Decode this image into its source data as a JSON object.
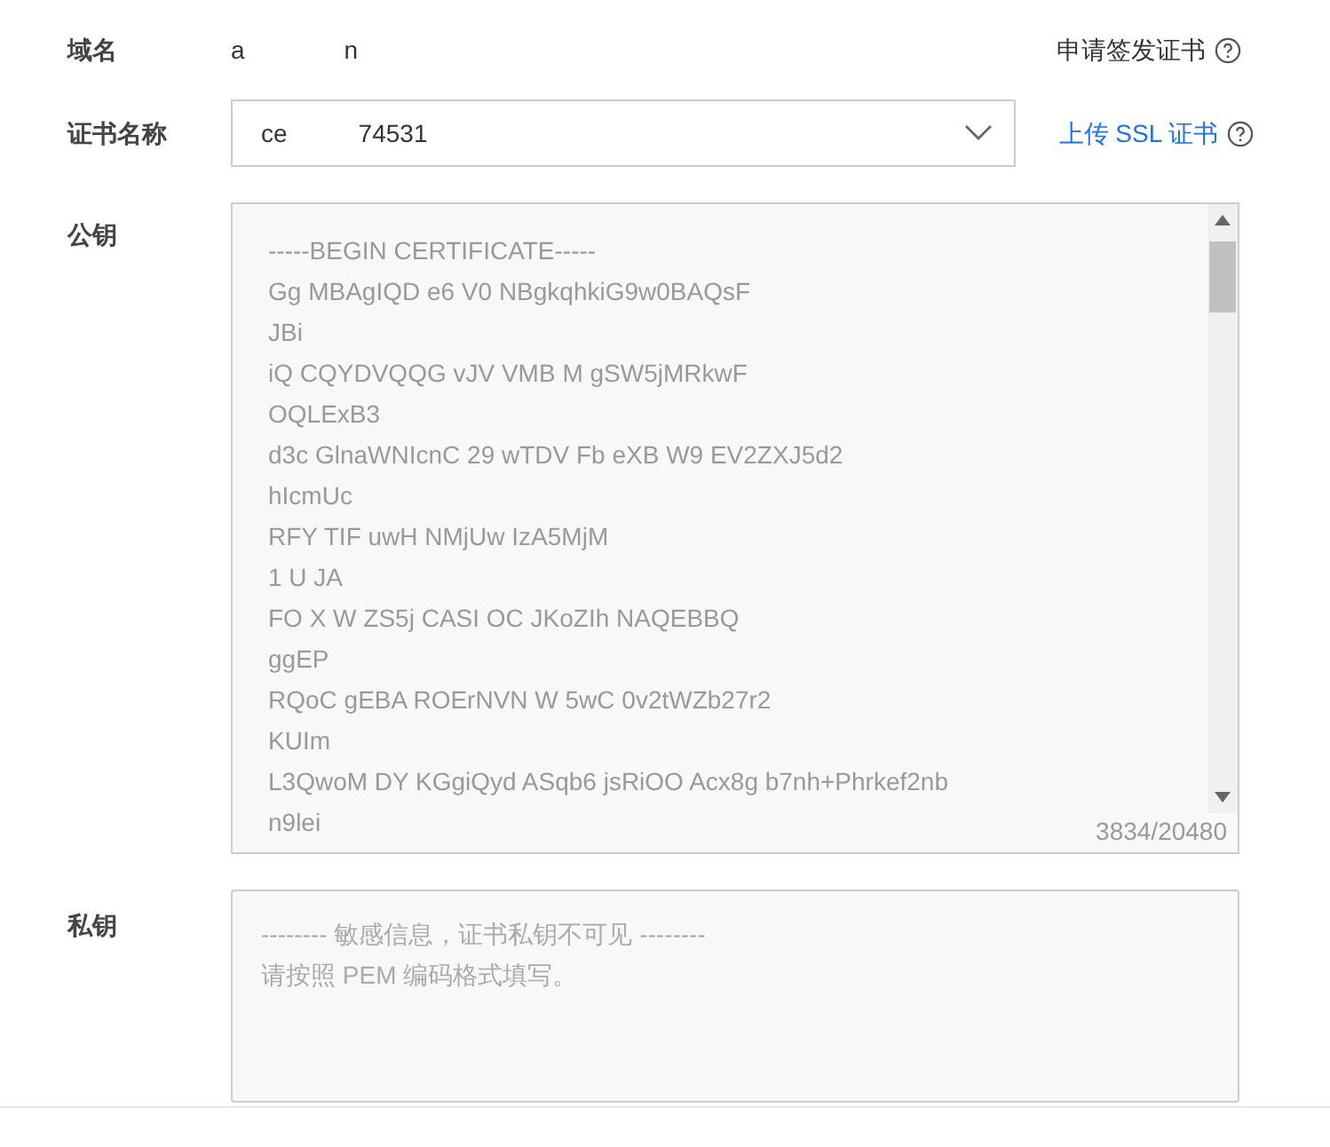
{
  "domain": {
    "label": "域名",
    "value_parts": [
      "a",
      "n"
    ],
    "action": "申请签发证书"
  },
  "cert_name": {
    "label": "证书名称",
    "value_parts": [
      "ce",
      "74531"
    ],
    "link": "上传 SSL 证书"
  },
  "public_key": {
    "label": "公钥",
    "lines": [
      "-----BEGIN CERTIFICATE-----",
      "Gg MBAgIQD e6 V0 NBgkqhkiG9w0BAQsF",
      "JBi",
      "iQ CQYDVQQG vJV VMB M gSW5jMRkwF",
      "OQLExB3",
      "d3c GlnaWNIcnC 29 wTDV Fb eXB W9 EV2ZXJ5d2",
      "hIcmUc",
      "RFY TIF uwH NMjUw IzA5MjM",
      "1 U JA",
      "FO X W ZS5j CASI OC JKoZIh NAQEBBQ",
      "ggEP",
      "RQoC gEBA ROErNVN W 5wC 0v2tWZb27r2",
      "KUIm",
      "L3QwoM DY KGgiQyd ASqb6 jsRiOO Acx8g b7nh+Phrkef2nb",
      "n9lei"
    ],
    "counter": "3834/20480"
  },
  "private_key": {
    "label": "私钥",
    "placeholder": "-------- 敏感信息，证书私钥不可见 --------\n请按照 PEM 编码格式填写。"
  }
}
